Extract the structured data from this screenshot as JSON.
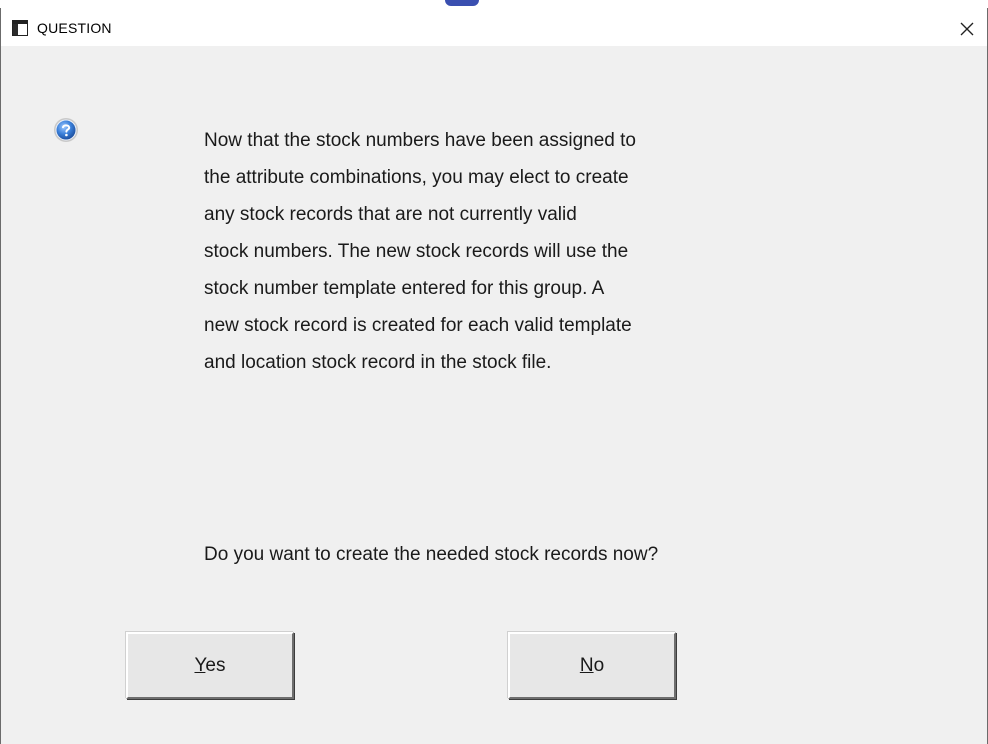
{
  "window": {
    "title": "QUESTION",
    "close_glyph": "✕"
  },
  "icons": {
    "title_icon": "window-icon",
    "message_icon": "question-help-icon",
    "close_icon": "close-icon"
  },
  "message": {
    "lines": [
      "Now that the stock numbers have been assigned to",
      "the attribute combinations, you may elect to create",
      "any stock records that are not currently valid",
      "stock numbers.  The new stock records will use the",
      "stock number template entered for this group.  A",
      "new stock record is created for each valid template",
      "and location stock record in the stock file."
    ],
    "question": "Do you want to create the needed stock records now?"
  },
  "buttons": {
    "yes": {
      "mnemonic": "Y",
      "rest": "es"
    },
    "no": {
      "mnemonic": "N",
      "rest": "o"
    }
  },
  "colors": {
    "dialog_bg": "#f0f0f0",
    "titlebar_bg": "#ffffff",
    "help_icon_blue": "#2f6fc6"
  }
}
